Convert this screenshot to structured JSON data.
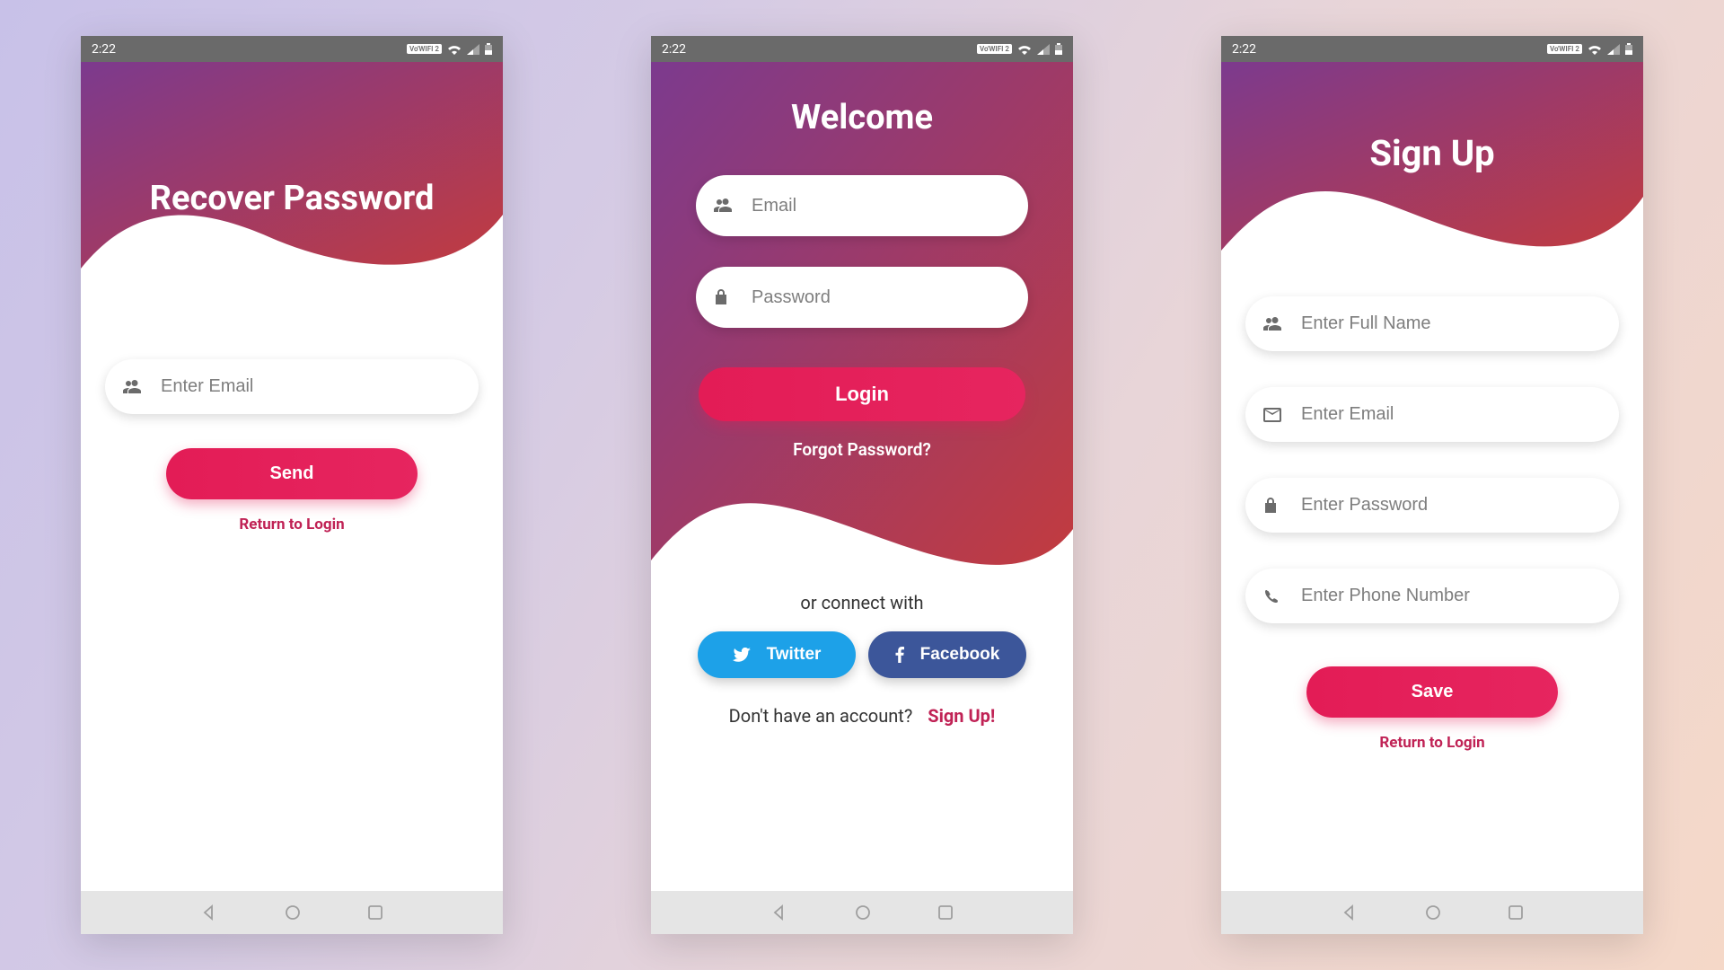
{
  "statusbar": {
    "time": "2:22",
    "wifi_label": "Vo'WIFI 2"
  },
  "screen1": {
    "title": "Recover Password",
    "email_placeholder": "Enter Email",
    "send_label": "Send",
    "return_label": "Return to Login"
  },
  "screen2": {
    "title": "Welcome",
    "email_placeholder": "Email",
    "password_placeholder": "Password",
    "login_label": "Login",
    "forgot_label": "Forgot Password?",
    "connect_label": "or connect with",
    "twitter_label": "Twitter",
    "facebook_label": "Facebook",
    "signup_prompt": "Don't have an account?",
    "signup_link": "Sign Up!"
  },
  "screen3": {
    "title": "Sign Up",
    "name_placeholder": "Enter Full Name",
    "email_placeholder": "Enter Email",
    "password_placeholder": "Enter Password",
    "phone_placeholder": "Enter Phone Number",
    "save_label": "Save",
    "return_label": "Return to Login"
  },
  "colors": {
    "accent": "#e31c56",
    "twitter": "#1da1e8",
    "facebook": "#3c569a"
  }
}
